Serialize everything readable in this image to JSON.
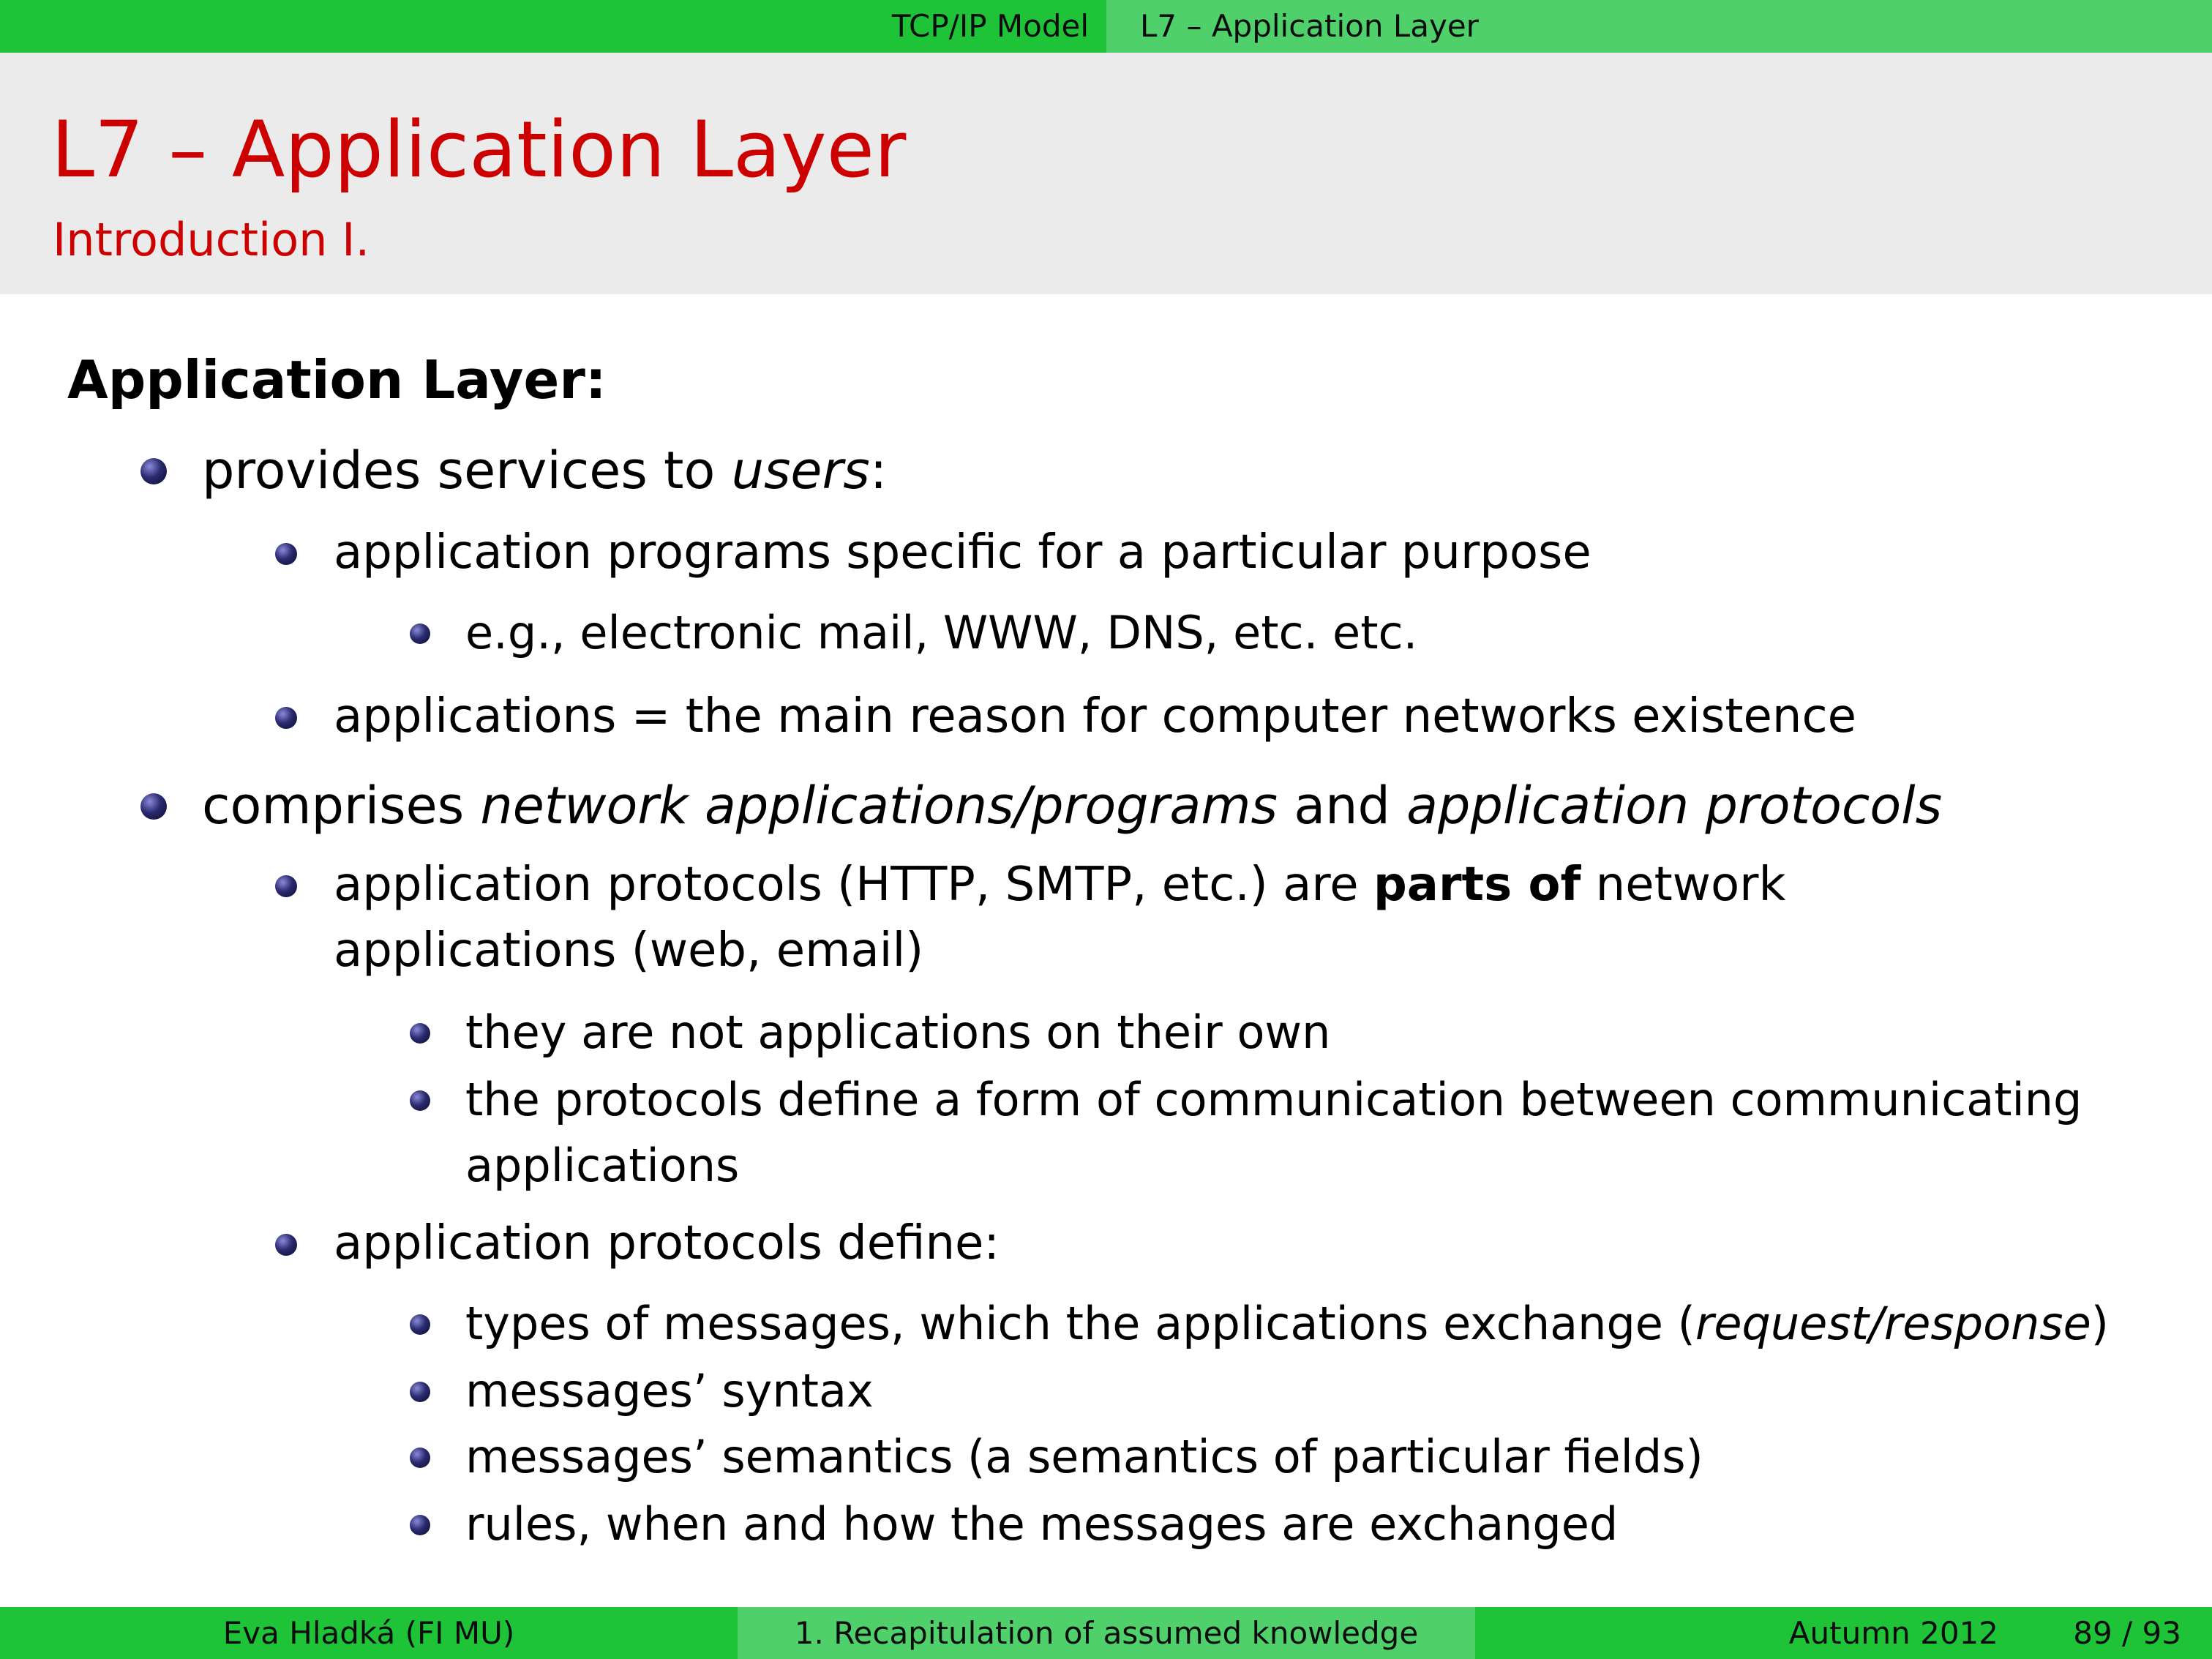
{
  "nav": {
    "section": "TCP/IP Model",
    "subsection": "L7 – Application Layer"
  },
  "title": "L7 – Application Layer",
  "subtitle": "Introduction I.",
  "heading": "Application Layer:",
  "items": {
    "i1": {
      "text": "provides services to ",
      "em": "users",
      "after": ":"
    },
    "i1a": {
      "text": "application programs specific for a particular purpose"
    },
    "i1a1": {
      "text": "e.g., electronic mail, WWW, DNS, etc. etc."
    },
    "i1b": {
      "text": "applications = the main reason for computer networks existence"
    },
    "i2": {
      "pre": "comprises ",
      "em1": "network applications/programs",
      "mid": " and ",
      "em2": "application protocols"
    },
    "i2a": {
      "pre": "application protocols (HTTP, SMTP, etc.) are ",
      "strong": "parts of",
      "post": " network",
      "line2": "applications (web, email)"
    },
    "i2a1": {
      "text": "they are not applications on their own"
    },
    "i2a2": {
      "text": "the protocols define a form of communication between communicating",
      "line2": "applications"
    },
    "i2b": {
      "text": "application protocols define:"
    },
    "i2b1": {
      "pre": "types of messages, which the applications exchange (",
      "em": "request/response",
      "post": ")"
    },
    "i2b2": {
      "text": "messages’ syntax"
    },
    "i2b3": {
      "text": "messages’ semantics (a semantics of particular fields)"
    },
    "i2b4": {
      "text": "rules, when and how the messages are exchanged"
    }
  },
  "footer": {
    "author": "Eva Hladká  (FI MU)",
    "course": "1. Recapitulation of assumed knowledge",
    "date": "Autumn 2012",
    "page": "89 / 93"
  },
  "colors": {
    "accent_green": "#1ec338",
    "accent_green_light": "#4fd06a",
    "title_red": "#cc0000",
    "title_bg": "#ebebeb"
  }
}
